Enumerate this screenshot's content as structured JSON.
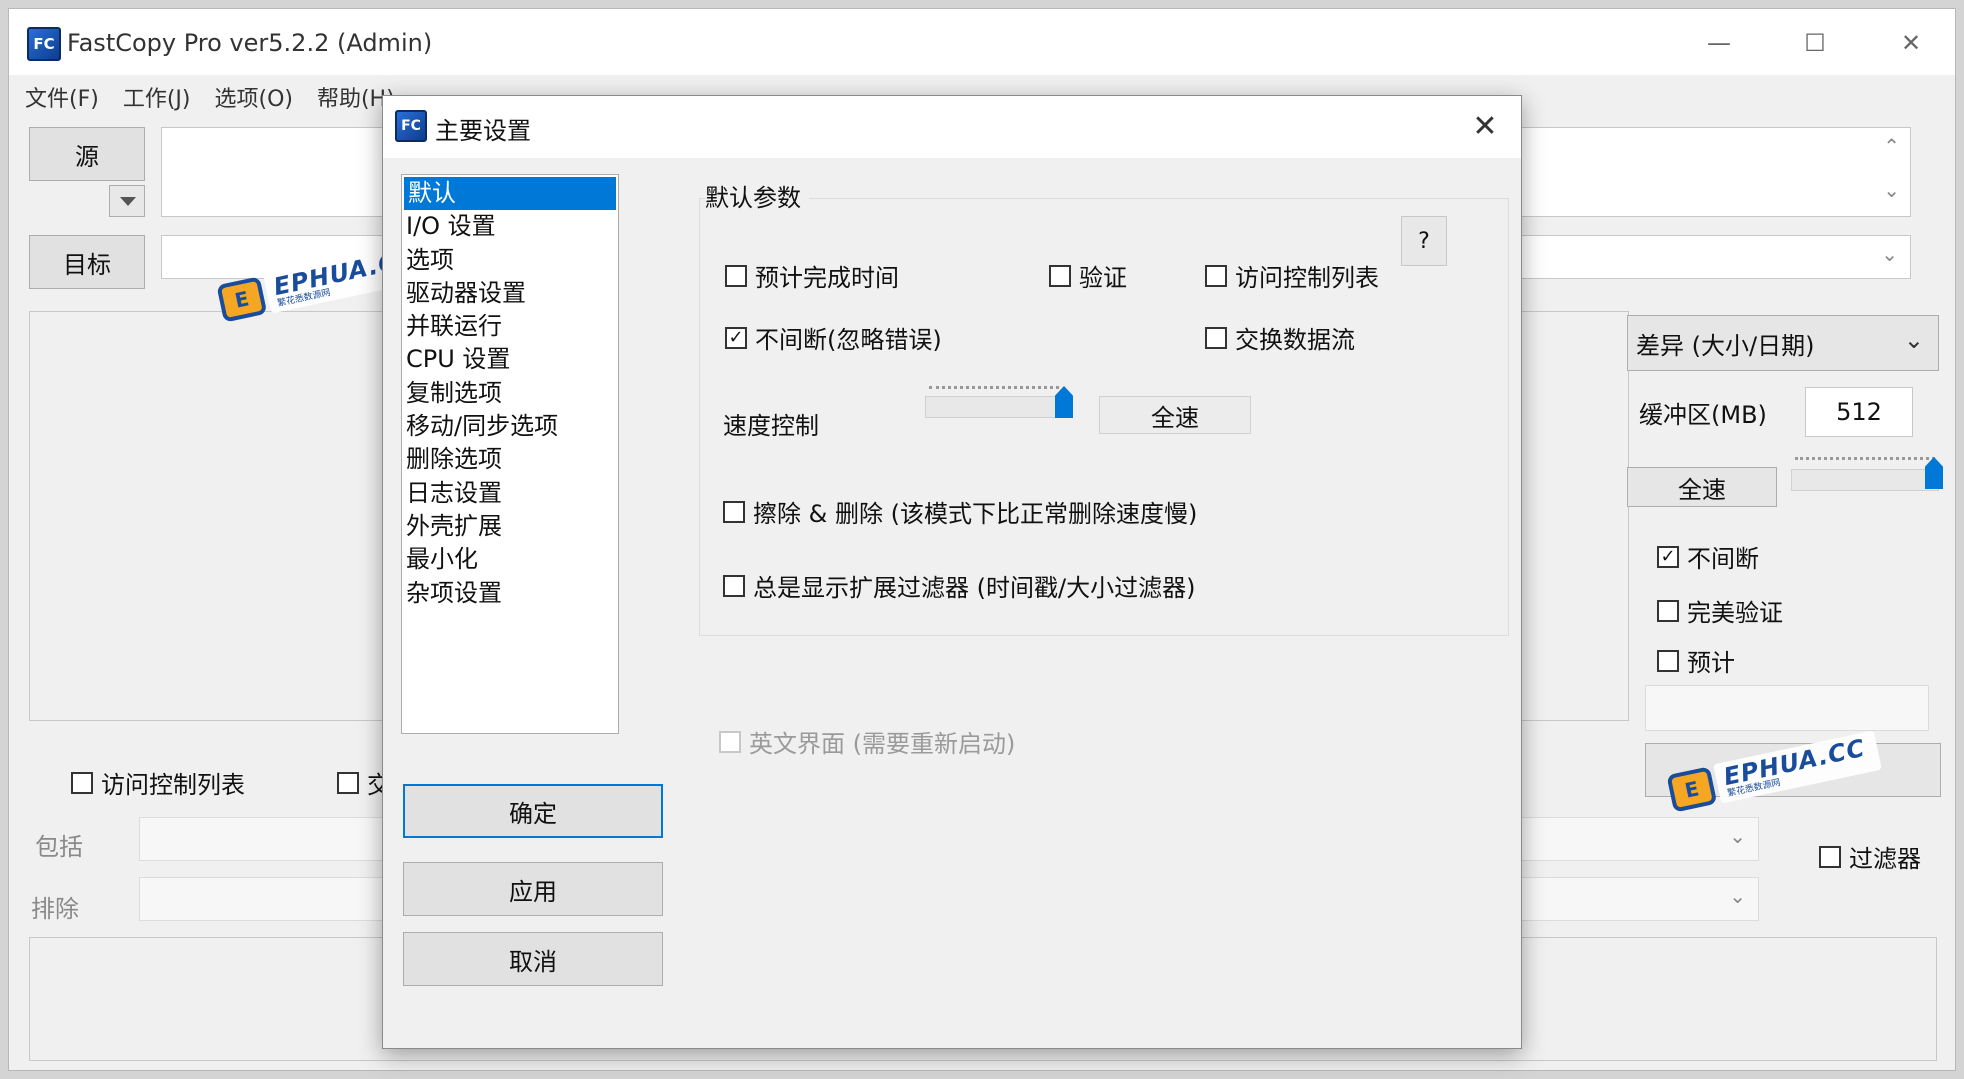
{
  "window": {
    "title": "FastCopy Pro ver5.2.2 (Admin)",
    "minimize": "—",
    "maximize": "☐",
    "close": "✕"
  },
  "menu": [
    "文件(F)",
    "工作(J)",
    "选项(O)",
    "帮助(H)"
  ],
  "main": {
    "source_button": "源",
    "target_button": "目标",
    "mode_select": "差异 (大小/日期)",
    "buffer_label": "缓冲区(MB)",
    "buffer_value": "512",
    "full_speed_button": "全速",
    "chk_continue": "不间断",
    "chk_perfect_verify": "完美验证",
    "chk_estimate": "预计",
    "chk_acl": "访问控制列表",
    "chk_stream_partial": "交",
    "include_label": "包括",
    "exclude_label": "排除",
    "chk_filter": "过滤器",
    "continue_checked": "✓"
  },
  "dialog": {
    "title": "主要设置",
    "close": "✕",
    "categories": [
      "默认",
      "I/O 设置",
      "选项",
      "驱动器设置",
      "并联运行",
      "CPU 设置",
      "复制选项",
      "移动/同步选项",
      "删除选项",
      "日志设置",
      "外壳扩展",
      "最小化",
      "杂项设置"
    ],
    "group_title": "默认参数",
    "help": "?",
    "chk_estimate_time": "预计完成时间",
    "chk_verify": "验证",
    "chk_acl": "访问控制列表",
    "chk_continue_ignore": "不间断(忽略错误)",
    "chk_continue_checked": "✓",
    "chk_alt_stream": "交换数据流",
    "speed_label": "速度控制",
    "speed_value": "全速",
    "chk_wipe_delete": "擦除 & 删除 (该模式下比正常删除速度慢)",
    "chk_ext_filter": "总是显示扩展过滤器 (时间戳/大小过滤器)",
    "chk_english_ui": "英文界面 (需要重新启动)",
    "ok_button": "确定",
    "apply_button": "应用",
    "cancel_button": "取消"
  },
  "watermark": {
    "text": "EPHUA.CC",
    "sub": "繁花悉数源网",
    "logo": "E"
  }
}
